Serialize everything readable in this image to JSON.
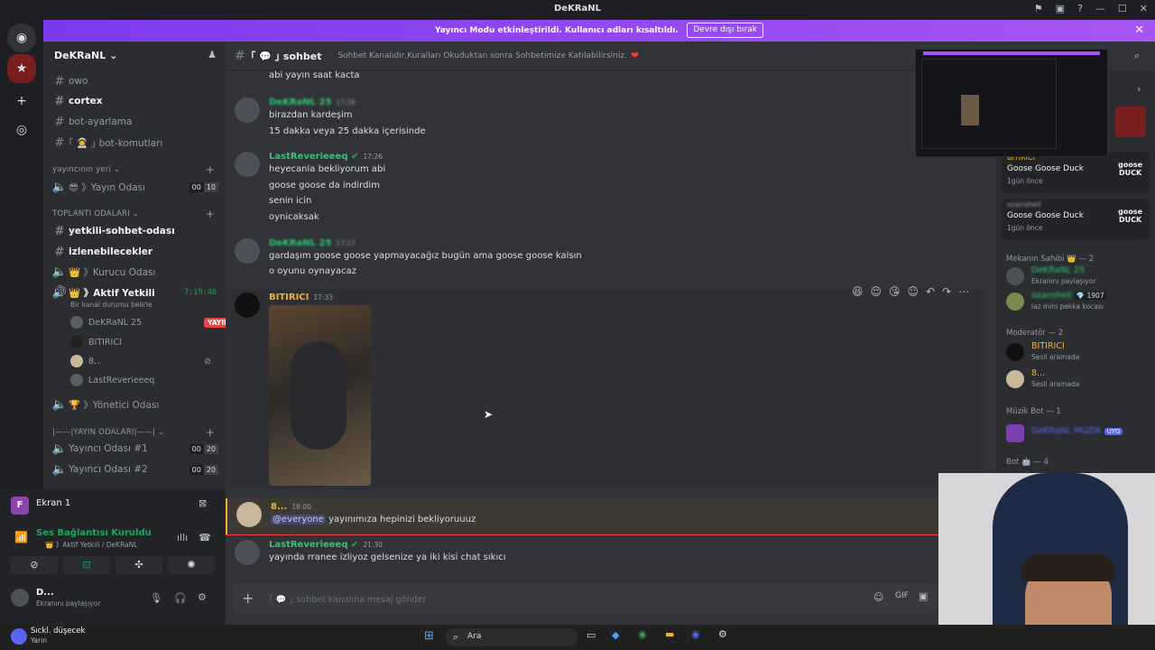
{
  "window": {
    "title": "DeKRaNL"
  },
  "banner": {
    "text": "Yayıncı Modu etkinleştirildi. Kullanıcı adları kısaltıldı.",
    "button": "Devre dışı bırak"
  },
  "server": {
    "name": "DeKRaNL"
  },
  "channels": {
    "top": [
      "owo",
      "cortex",
      "bot-ayarlama",
      "｢ 👨‍🚀 ｣ bot-komutları"
    ],
    "cat1": "yayıncının yeri",
    "yayin_odasi": {
      "label": "😎 》Yayın Odası",
      "count_a": "00",
      "count_b": "10"
    },
    "cat2": "TOPLANTI ODALARI",
    "yetkili": "yetkili-sohbet-odası",
    "izlenebilecekler": "izlenebilecekler",
    "kurucu": "👑 》Kurucu Odası",
    "aktif": "👑 》Aktif Yetkili",
    "aktif_time": "7:19:46",
    "aktif_status": "Bir kanal durumu belirle",
    "voice_members": [
      "DeKRaNL 25",
      "BITIRICI",
      "8...",
      "LastReverieeeq"
    ],
    "live_badge": "YAYINDA",
    "yonetici": "🏆 》Yönetici Odası",
    "cat3": "|——|YAYIN ODALARI|——|",
    "yayinci1": {
      "label": "Yayıncı Odası #1",
      "count_a": "00",
      "count_b": "20"
    },
    "yayinci2": {
      "label": "Yayıncı Odası #2",
      "count_a": "00",
      "count_b": "20"
    }
  },
  "voice_panel": {
    "screen_label": "Ekran 1",
    "connected": "Ses Bağlantısı Kuruldu",
    "connected_sub": "👑 》Aktif Yetkili / DeKRaNL",
    "user_name": "D...",
    "user_status": "Ekranını paylaşıyor"
  },
  "chat_header": {
    "channel": "｢ 💬 ｣ sohbet",
    "topic": "Sohbet Kanalıdır,Kuralları Okuduktan sonra Sohbetimize Katılabilirsiniz."
  },
  "messages": [
    {
      "lines": [
        "abi yayın saat kacta"
      ]
    },
    {
      "author": "DeKRaNL 25",
      "time": "17:26",
      "lines": [
        "birazdan kardeşim",
        "15 dakka veya 25 dakka içerisinde"
      ]
    },
    {
      "author": "LastReverieeeq",
      "time": "17:26",
      "lines": [
        "heyecanla bekliyorum abi",
        "goose goose da indirdim",
        "senin icin",
        "oynicaksak"
      ]
    },
    {
      "author": "DeKRaNL 25",
      "time": "17:27",
      "lines": [
        "gardaşım goose goose yapmayacağız bugün ama goose goose kalsın",
        "o oyunu oynayacaz"
      ]
    },
    {
      "author": "BITIRICI",
      "time": "17:33"
    },
    {
      "author": "8...",
      "time": "18:00",
      "mention": "@everyone",
      "text": "yayınımıza hepinizi bekliyoruuuz"
    },
    {
      "author": "LastReverieeeq",
      "time": "21:30",
      "lines": [
        "yayında rranee izliyoz gelsenize ya iki kisi chat sıkıcı"
      ]
    }
  ],
  "composer": {
    "placeholder": "｢ 💬 ｣ sohbet kanalına mesaj gönder"
  },
  "members": {
    "cards": [
      {
        "who": "BITIRICI",
        "game": "Goose Goose Duck",
        "ago": "1gün önce"
      },
      {
        "who": "ozanshell",
        "game": "Goose Goose Duck",
        "ago": "1gün önce"
      }
    ],
    "group1": "Mekanın Sahibi 👑 — 2",
    "owner1": {
      "name": "DeKRaNL 25",
      "sub": "Ekranını paylaşıyor"
    },
    "owner2": {
      "name": "ozanshell",
      "badge": "💎 1907",
      "sub": "laz mini pekka kocası"
    },
    "group2": "Moderatör — 2",
    "mod1": {
      "name": "BITIRICI",
      "sub": "Sesli aramada"
    },
    "mod2": {
      "name": "8...",
      "sub": "Sesli aramada"
    },
    "group3": "Müzik Bot — 1",
    "bot1": {
      "name": "DeKRaNL MÜZİK",
      "tag": "UYG"
    },
    "group4": "Bot 🤖 — 4"
  },
  "taskbar": {
    "search": "Ara",
    "weather": "Sıckl. düşecek",
    "weather_sub": "Yarın"
  },
  "colors": {
    "banner": "#a855f7",
    "author_green": "#2dc770",
    "author_gold": "#f0b232",
    "live": "#ed4245"
  }
}
